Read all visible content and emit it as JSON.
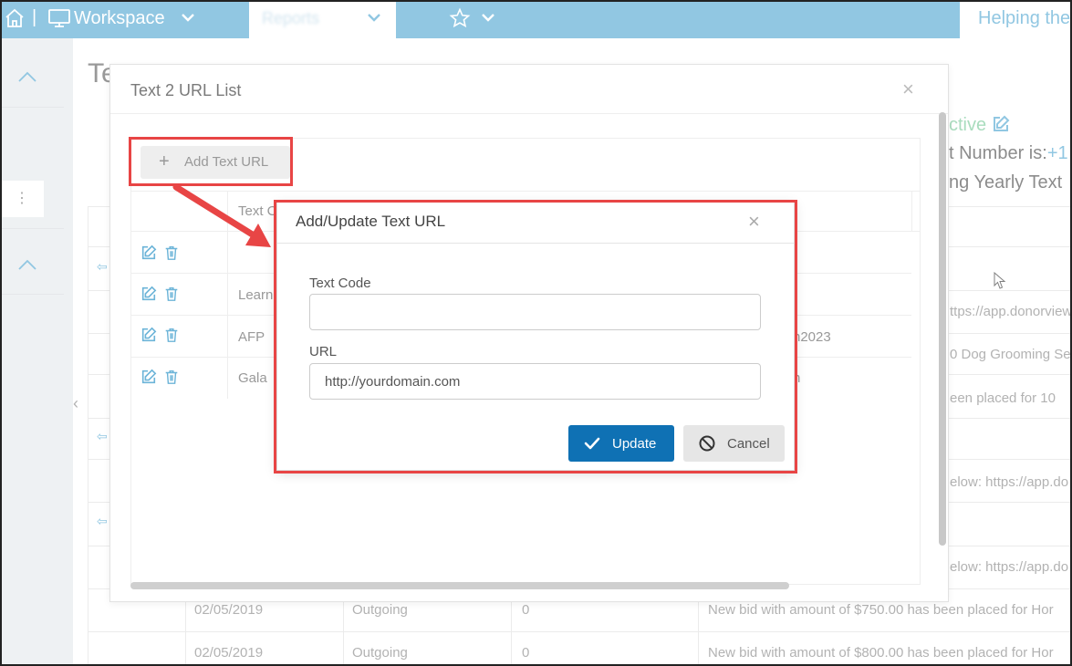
{
  "topbar": {
    "workspace_label": "Workspace",
    "reports_label": "Reports",
    "right_label": "Helping the"
  },
  "background": {
    "title": "Te",
    "status": "ctive",
    "number_label": "t Number is:",
    "number_value": "+1",
    "yearly": "ng Yearly Text",
    "fragments": [
      "ttps://app.donorview",
      "0 Dog Grooming Se",
      "een placed for 10",
      "elow: https://app.do",
      "elow: https://app.do"
    ],
    "rows": [
      {
        "date": "02/05/2019",
        "direction": "Outgoing",
        "count": "0",
        "message": "New bid with amount of $750.00 has been placed for Hor"
      },
      {
        "date": "02/05/2019",
        "direction": "Outgoing",
        "count": "0",
        "message": "New bid with amount of $800.00 has been placed for Hor"
      }
    ]
  },
  "text_url_list": {
    "title": "Text 2 URL List",
    "close": "×",
    "add_button": "Add Text URL",
    "column_text_code": "Text C",
    "rows": [
      {
        "code": "",
        "url": ""
      },
      {
        "code": "Learn",
        "url": ""
      },
      {
        "code": "AFP",
        "url": "n2023"
      },
      {
        "code": "Gala",
        "url": "n"
      }
    ]
  },
  "dialog": {
    "title": "Add/Update Text URL",
    "close": "×",
    "text_code_label": "Text Code",
    "text_code_value": "",
    "url_label": "URL",
    "url_value": "http://yourdomain.com",
    "update_label": "Update",
    "cancel_label": "Cancel"
  },
  "colors": {
    "accent": "#6cb4d8",
    "primary_button": "#0f71b4",
    "highlight": "#e84545"
  }
}
